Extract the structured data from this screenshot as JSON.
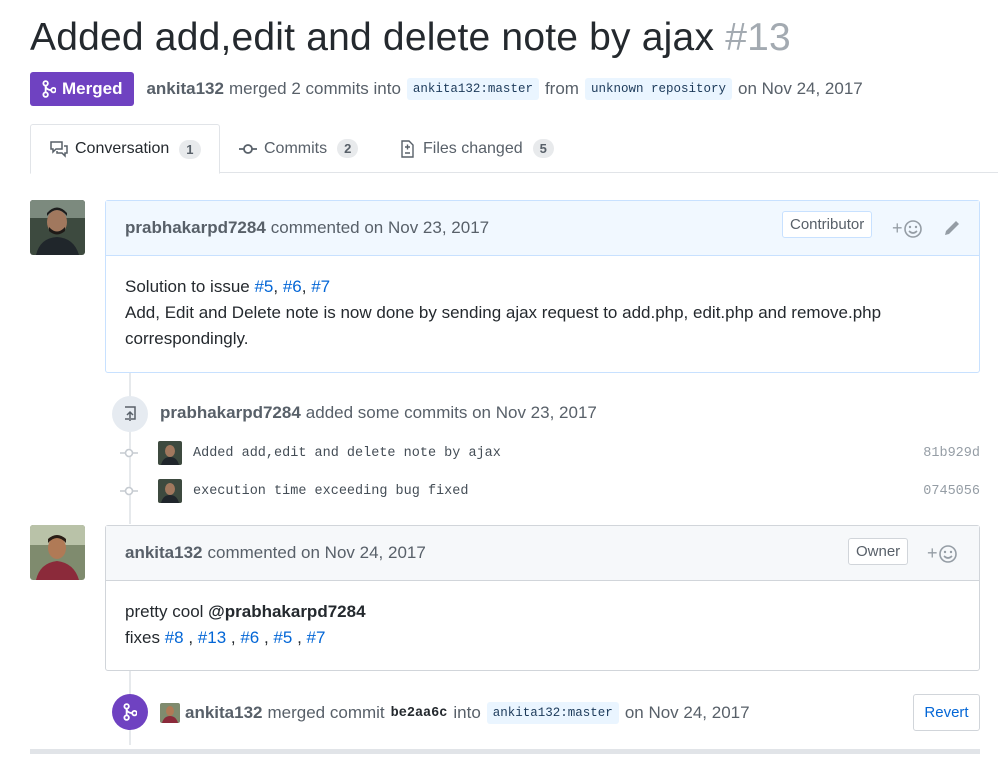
{
  "pr": {
    "title": "Added add,edit and delete note by ajax",
    "number": "#13",
    "state": "Merged",
    "author": "ankita132",
    "action": "merged 2 commits into",
    "base_branch": "ankita132:master",
    "from_word": "from",
    "head_branch": "unknown repository",
    "date_text": "on Nov 24, 2017"
  },
  "tabs": [
    {
      "label": "Conversation",
      "count": "1",
      "icon": "comment-discussion-icon"
    },
    {
      "label": "Commits",
      "count": "2",
      "icon": "git-commit-icon"
    },
    {
      "label": "Files changed",
      "count": "5",
      "icon": "file-diff-icon"
    }
  ],
  "comment1": {
    "author": "prabhakarpd7284",
    "meta": "commented on Nov 23, 2017",
    "role": "Contributor",
    "react": "+",
    "body_prefix": "Solution to issue ",
    "refs": [
      "#5",
      "#6",
      "#7"
    ],
    "sep": ", ",
    "body_line2": "Add, Edit and Delete note is now done by sending ajax request to add.php, edit.php and remove.php correspondingly."
  },
  "commits_event": {
    "author": "prabhakarpd7284",
    "meta": "added some commits on Nov 23, 2017",
    "commits": [
      {
        "message": "Added add,edit and delete note by ajax",
        "sha": "81b929d"
      },
      {
        "message": "execution time exceeding bug fixed",
        "sha": "0745056"
      }
    ]
  },
  "comment2": {
    "author": "ankita132",
    "meta": "commented on Nov 24, 2017",
    "role": "Owner",
    "react": "+",
    "line1_prefix": "pretty cool ",
    "mention": "@prabhakarpd7284",
    "line2_prefix": "fixes ",
    "refs": [
      "#8",
      "#13",
      "#6",
      "#5",
      "#7"
    ],
    "sep": " , "
  },
  "merge_event": {
    "author": "ankita132",
    "action": "merged commit",
    "sha": "be2aa6c",
    "into": "into",
    "branch": "ankita132:master",
    "date_text": "on Nov 24, 2017",
    "revert_label": "Revert"
  },
  "colors": {
    "merged": "#6f42c1",
    "link": "#0366d6",
    "contributor_header": "#f1f8ff",
    "owner_header": "#f6f8fa"
  }
}
